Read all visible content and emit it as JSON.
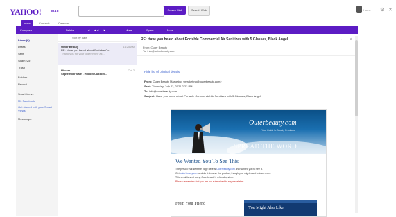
{
  "header": {
    "logo": "YAHOO!",
    "logo_sub": "MAIL",
    "search_placeholder": "",
    "search_mail_label": "Search Mail",
    "search_web_label": "Search Web",
    "user_name": "Home"
  },
  "tabs": [
    "Inbox",
    "Contacts",
    "Calendar"
  ],
  "toolbar": {
    "compose": "Compose",
    "delete": "Delete",
    "move": "Move",
    "spam": "Spam",
    "more": "More"
  },
  "sidebar": {
    "items": [
      "Inbox (2)",
      "Drafts",
      "Sent",
      "Spam (25)",
      "Trash",
      "Folders",
      "Recent"
    ],
    "smart_views": "Smart Views",
    "sub_items": [
      "Mt. Facebook",
      "Get started with your Smart Views"
    ],
    "messenger": "Messenger"
  },
  "message_list": {
    "sort_label": "Sort by date",
    "messages": [
      {
        "from": "Outer Beauty",
        "subject": "RE: Have you heard about Portable Co...",
        "preview": "Thank you for your order (view all...",
        "date": "11:25 AM"
      },
      {
        "from": "Hilcom",
        "subject": "September Sale - Hilcom Custom...",
        "preview": "",
        "date": "Oct 2"
      }
    ]
  },
  "pane": {
    "subject": "RE: Have you heard about Portable Commercial Air Sanitizes with 5 Glasses, Black Angel",
    "actions": "← → ✕",
    "from_label": "From: Outer Beauty",
    "to_label": "To: info@outerbeauty.com",
    "hide_link": "Hide list of original details",
    "headers": [
      {
        "k": "From:",
        "v": "Outer Beauty Marketing <marketing@outerbeauty.com>"
      },
      {
        "k": "Sent:",
        "v": "Thursday, July 22, 2021 2:22 PM"
      },
      {
        "k": "To:",
        "v": "info@outerbeauty.com"
      },
      {
        "k": "Subject:",
        "v": "Have you heard about Portable Commercial Air Sanitizes with 5 Glasses, Black Angel"
      }
    ]
  },
  "newsletter": {
    "brand": "Outerbeauty.com",
    "brand_tag": "Your Guide to Beauty Products",
    "hero_text": "SPREAD THE WORD",
    "heading": "We Wanted You To See This",
    "lines": [
      {
        "pre": "The person that sent the page here is ",
        "link": "Outerbeauty.com",
        "post": " and wanted you to see it."
      },
      {
        "pre": "Get ",
        "link": "outerbeauty.com",
        "post": " and do it: browse the product, though you might want to learn more."
      },
      {
        "pre": "This email is sent using Outerbeauty's referral system.",
        "link": "",
        "post": ""
      }
    ],
    "red_line": "Please remember that you are not subscribed to any newsletter.",
    "from_label": "From Your Friend",
    "box_text": "You Might Also Like"
  },
  "colors": {
    "brand_purple": "#5c1cc4",
    "link_blue": "#3a5fcd"
  }
}
